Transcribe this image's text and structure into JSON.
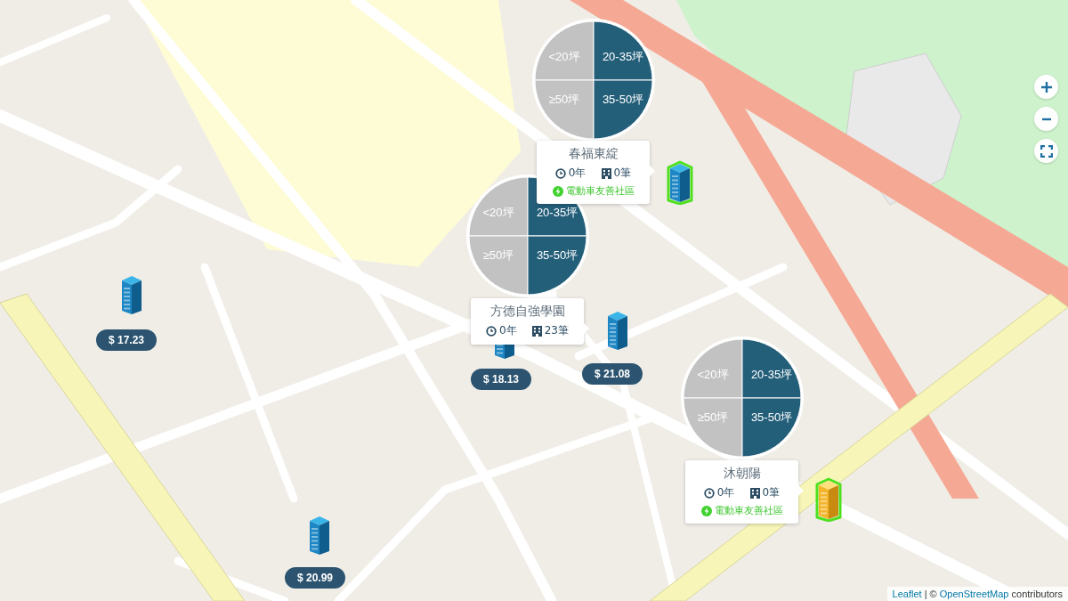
{
  "clusters": [
    {
      "segments": [
        {
          "label": "<20坪",
          "active": false
        },
        {
          "label": "20-35坪",
          "active": true
        },
        {
          "label": "≥50坪",
          "active": false
        },
        {
          "label": "35-50坪",
          "active": true
        }
      ],
      "popup": {
        "name": "春福東綻",
        "years": "0年",
        "units": "0筆",
        "badge": "電動車友善社區"
      }
    },
    {
      "segments": [
        {
          "label": "<20坪",
          "active": false
        },
        {
          "label": "20-35坪",
          "active": true
        },
        {
          "label": "≥50坪",
          "active": false
        },
        {
          "label": "35-50坪",
          "active": true
        }
      ],
      "popup": {
        "name": "方德自強學園",
        "years": "0年",
        "units": "23筆"
      }
    },
    {
      "segments": [
        {
          "label": "<20坪",
          "active": false
        },
        {
          "label": "20-35坪",
          "active": true
        },
        {
          "label": "≥50坪",
          "active": false
        },
        {
          "label": "35-50坪",
          "active": true
        }
      ],
      "popup": {
        "name": "沐朝陽",
        "years": "0年",
        "units": "0筆",
        "badge": "電動車友善社區"
      }
    }
  ],
  "buildings": [
    {
      "kind": "standard",
      "highlighted": false,
      "price": "$ 17.23"
    },
    {
      "kind": "standard",
      "highlighted": false,
      "price": "$ 18.13"
    },
    {
      "kind": "standard",
      "highlighted": false,
      "price": "$ 21.08"
    },
    {
      "kind": "standard",
      "highlighted": false,
      "price": "$ 20.99"
    },
    {
      "kind": "standard",
      "highlighted": true
    },
    {
      "kind": "featured",
      "highlighted": true
    }
  ],
  "map_controls": [
    {
      "kind": "zoom-in"
    },
    {
      "kind": "zoom-out"
    },
    {
      "kind": "fullscreen"
    }
  ],
  "attribution": [
    {
      "kind": "link",
      "text": "Leaflet"
    },
    {
      "kind": "text",
      "text": "| ©"
    },
    {
      "kind": "link",
      "text": "OpenStreetMap"
    },
    {
      "kind": "text",
      "text": "contributors"
    }
  ]
}
